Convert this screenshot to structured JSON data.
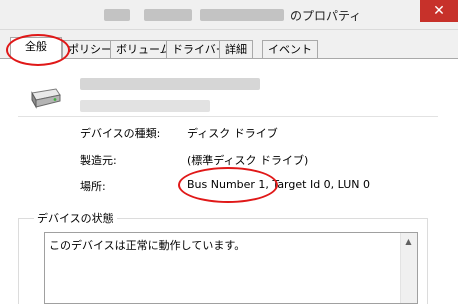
{
  "window": {
    "title_suffix": "のプロパティ",
    "close_glyph": "✕"
  },
  "tabs": [
    {
      "label": "全般",
      "active": true
    },
    {
      "label": "ポリシー"
    },
    {
      "label": "ボリューム"
    },
    {
      "label": "ドライバー"
    },
    {
      "label": "詳細"
    },
    {
      "label": "イベント"
    }
  ],
  "device": {
    "icon": "disk-drive-icon",
    "properties": [
      {
        "label": "デバイスの種類:",
        "value": "ディスク ドライブ"
      },
      {
        "label": "製造元:",
        "value": "(標準ディスク ドライブ)"
      },
      {
        "label": "場所:",
        "value": "Bus Number 1, Target Id 0, LUN 0"
      }
    ]
  },
  "status": {
    "group_title": "デバイスの状態",
    "text": "このデバイスは正常に動作しています。"
  },
  "colors": {
    "highlight_ring": "#e01818",
    "close_button": "#c7312a"
  }
}
